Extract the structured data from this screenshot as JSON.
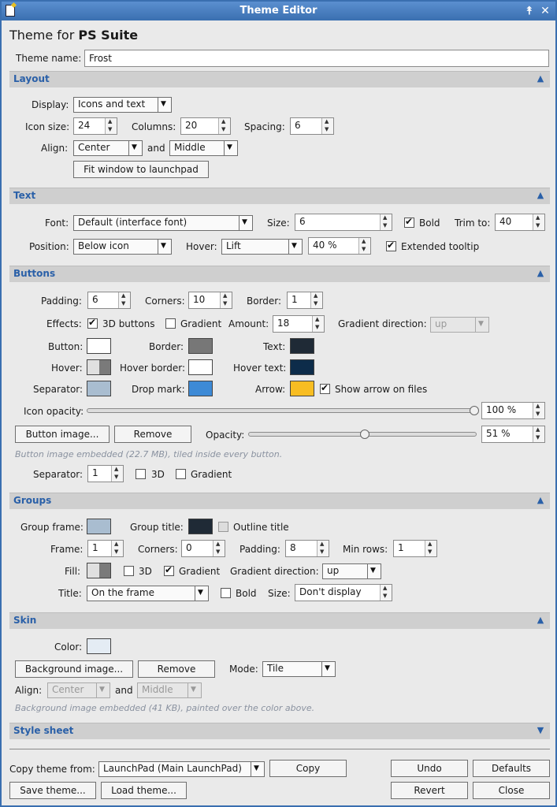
{
  "window": {
    "title": "Theme Editor",
    "btn_shade": "⯭",
    "btn_close": "✕"
  },
  "heading": {
    "prefix": "Theme for ",
    "suite": "PS Suite"
  },
  "theme_name": {
    "label": "Theme name:",
    "value": "Frost"
  },
  "layout": {
    "title": "Layout",
    "display_label": "Display:",
    "display_value": "Icons and text",
    "icon_size_label": "Icon size:",
    "icon_size": "24",
    "columns_label": "Columns:",
    "columns": "20",
    "spacing_label": "Spacing:",
    "spacing": "6",
    "align_label": "Align:",
    "align_h": "Center",
    "and": "and",
    "align_v": "Middle",
    "fit_button": "Fit window to launchpad"
  },
  "text": {
    "title": "Text",
    "font_label": "Font:",
    "font_value": "Default (interface font)",
    "size_label": "Size:",
    "size": "6",
    "bold_label": "Bold",
    "bold_checked": true,
    "trim_label": "Trim to:",
    "trim": "40",
    "position_label": "Position:",
    "position_value": "Below icon",
    "hover_label": "Hover:",
    "hover_value": "Lift",
    "hover_pct": "40 %",
    "ext_tooltip_label": "Extended tooltip",
    "ext_tooltip_checked": true
  },
  "buttons": {
    "title": "Buttons",
    "padding_label": "Padding:",
    "padding": "6",
    "corners_label": "Corners:",
    "corners": "10",
    "border_label": "Border:",
    "border": "1",
    "effects_label": "Effects:",
    "btn3d_label": "3D buttons",
    "btn3d_checked": true,
    "gradient_label": "Gradient",
    "gradient_checked": false,
    "amount_label": "Amount:",
    "amount": "18",
    "gradient_dir_label": "Gradient direction:",
    "gradient_dir": "up",
    "button_color_label": "Button:",
    "border_color_label": "Border:",
    "text_color_label": "Text:",
    "hover_color_label": "Hover:",
    "hover_border_label": "Hover border:",
    "hover_text_label": "Hover text:",
    "separator_color_label": "Separator:",
    "drop_mark_label": "Drop mark:",
    "arrow_label": "Arrow:",
    "show_arrow_label": "Show arrow on files",
    "show_arrow_checked": true,
    "colors": {
      "button": "#ffffff",
      "border": "#777777",
      "text": "#1f2a36",
      "hover_border": "#ffffff",
      "hover_text": "#0d2c4a",
      "separator": "#a9bdd0",
      "drop_mark": "#3d8ad6",
      "arrow": "#f8bd22"
    },
    "icon_opacity_label": "Icon opacity:",
    "icon_opacity": "100 %",
    "icon_opacity_value": 1.0,
    "button_image_button": "Button image...",
    "remove_button": "Remove",
    "opacity_label": "Opacity:",
    "opacity": "51 %",
    "opacity_value": 0.51,
    "image_note": "Button image embedded (22.7 MB), tiled inside every button.",
    "separator_label": "Separator:",
    "separator": "1",
    "sep3d_label": "3D",
    "sep3d_checked": false,
    "sep_gradient_label": "Gradient",
    "sep_gradient_checked": false
  },
  "groups": {
    "title": "Groups",
    "group_frame_label": "Group frame:",
    "group_title_label": "Group title:",
    "outline_title_label": "Outline title",
    "outline_title_checked": false,
    "colors": {
      "group_frame": "#a9bdd0",
      "group_title": "#1f2a36"
    },
    "frame_label": "Frame:",
    "frame": "1",
    "corners_label": "Corners:",
    "corners": "0",
    "padding_label": "Padding:",
    "padding": "8",
    "min_rows_label": "Min rows:",
    "min_rows": "1",
    "fill_label": "Fill:",
    "g3d_label": "3D",
    "g3d_checked": false,
    "ggradient_label": "Gradient",
    "ggradient_checked": true,
    "gradient_dir_label": "Gradient direction:",
    "gradient_dir": "up",
    "title_label": "Title:",
    "title_value": "On the frame",
    "bold_label": "Bold",
    "bold_checked": false,
    "size_label": "Size:",
    "size_value": "Don't display"
  },
  "skin": {
    "title": "Skin",
    "color_label": "Color:",
    "color": "#e4ecf4",
    "bg_image_button": "Background image...",
    "remove_button": "Remove",
    "mode_label": "Mode:",
    "mode": "Tile",
    "align_label": "Align:",
    "align_h": "Center",
    "and": "and",
    "align_v": "Middle",
    "note": "Background image embedded (41 KB), painted over the color above."
  },
  "style_sheet": {
    "title": "Style sheet"
  },
  "footer": {
    "copy_label": "Copy theme from:",
    "copy_source": "LaunchPad (Main LaunchPad)",
    "copy_button": "Copy",
    "undo_button": "Undo",
    "defaults_button": "Defaults",
    "save_button": "Save theme...",
    "load_button": "Load theme...",
    "revert_button": "Revert",
    "close_button": "Close"
  }
}
